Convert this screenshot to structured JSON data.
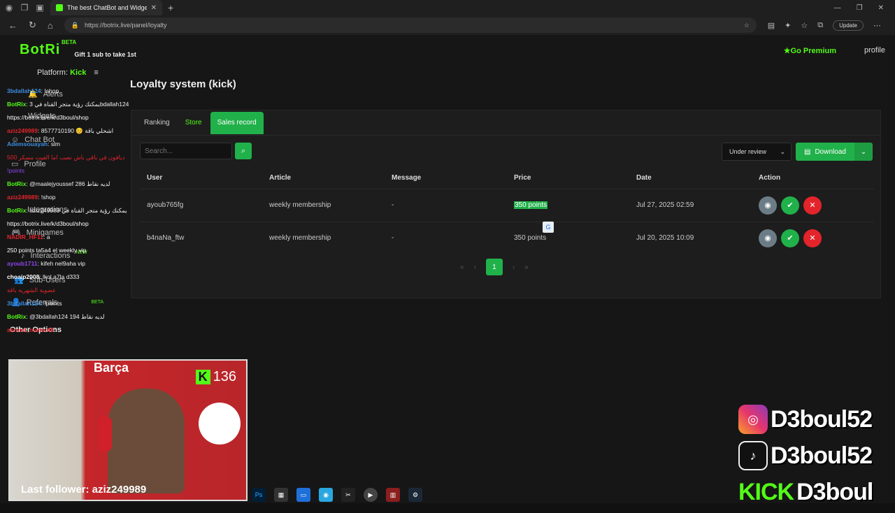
{
  "browser": {
    "tab_title": "The best ChatBot and Widgets fo",
    "url": "https://botrix.live/panel/loyalty",
    "update_label": "Update"
  },
  "header": {
    "logo": "BotRi",
    "beta": "BETA",
    "gift_text": "Gift 1 sub to take 1st",
    "premium": "Go Premium",
    "profile": "profile",
    "platform_label": "Platform:",
    "platform_value": "Kick"
  },
  "sidebar": {
    "items": [
      "Alerts",
      "Widgets",
      "Chat Bot",
      "Profile",
      "Integrations",
      "Minigames",
      "Interactions",
      "Sub-Users",
      "Referrals",
      "Other Options"
    ],
    "new_badge": "NEW",
    "beta_badge": "BETA"
  },
  "chat": [
    {
      "user": "3bdallah124",
      "msg": "!shop",
      "color": "#3b8de0"
    },
    {
      "user": "BotRix",
      "msg": "يمكنك رؤية متجر القناة في 3bdallah124",
      "color": "#53fc18"
    },
    {
      "user": "",
      "msg": "https://botrix.live/k/d3boul/shop",
      "color": "#ffffff"
    },
    {
      "user": "aziz249989",
      "msg": "8577710190 😊 اشحلي باقة",
      "color": "#e3242b"
    },
    {
      "user": "Ademsouayah",
      "msg": "slm",
      "color": "#3b8de0"
    },
    {
      "user": "",
      "msg": "ديافون في باقي باش نصب اما الفيت مسكر 500",
      "color": "#e3242b"
    },
    {
      "user": "",
      "msg": "!points",
      "color": "#8e44ec"
    },
    {
      "user": "BotRix",
      "msg": "@maalejyoussef 286 لديه نقاط",
      "color": "#53fc18"
    },
    {
      "user": "aziz249989",
      "msg": "!shop",
      "color": "#e3242b"
    },
    {
      "user": "BotRix",
      "msg": "aziz249989 يمكنك رؤية متجر القناة في",
      "color": "#53fc18"
    },
    {
      "user": "",
      "msg": "https://botrix.live/k/d3boul/shop",
      "color": "#ffffff"
    },
    {
      "user": "NADIR_HF11",
      "msg": "a",
      "color": "#e3242b"
    },
    {
      "user": "",
      "msg": "250 points ta5a4 el weekly vip",
      "color": "#ffffff"
    },
    {
      "user": "ayoub1711",
      "msg": "kifeh nel9aha vip",
      "color": "#8e44ec"
    },
    {
      "user": "choaip2008",
      "msg": "lkol a7la d333",
      "color": "#ffffff"
    },
    {
      "user": "",
      "msg": "عضوية الشهرية باقة",
      "color": "#e3242b"
    },
    {
      "user": "3bdallah124",
      "msg": "!points",
      "color": "#3b8de0"
    },
    {
      "user": "BotRix",
      "msg": "@3bdallah124 194 لديه نقاط",
      "color": "#53fc18"
    },
    {
      "user": "ahmed_maher48",
      "msg": "",
      "color": "#e3242b"
    }
  ],
  "main": {
    "title": "Loyalty system (kick)",
    "tabs": [
      "Ranking",
      "Store",
      "Sales record"
    ],
    "search_placeholder": "Search...",
    "status_select": "Under review",
    "download_label": "Download",
    "columns": [
      "User",
      "Article",
      "Message",
      "Price",
      "Date",
      "Action"
    ],
    "rows": [
      {
        "user": "ayoub765fg",
        "article": "weekly membership",
        "message": "-",
        "price": "350 points",
        "date": "Jul 27, 2025 02:59"
      },
      {
        "user": "b4naNa_ftw",
        "article": "weekly membership",
        "message": "-",
        "price": "350 points",
        "date": "Jul 20, 2025 10:09"
      }
    ],
    "pager": {
      "first": "«",
      "prev": "‹",
      "current": "1",
      "next": "›",
      "last": "»"
    }
  },
  "stream": {
    "kick_viewers": "136",
    "last_follower": "Last follower: aziz249989",
    "social_name": "D3boul52",
    "kick_word": "KICK",
    "kick_name": "D3boul",
    "jersey_text": "Barça"
  },
  "colors": {
    "accent": "#53fc18",
    "button_green": "#21b14a",
    "reject": "#e3242b"
  }
}
